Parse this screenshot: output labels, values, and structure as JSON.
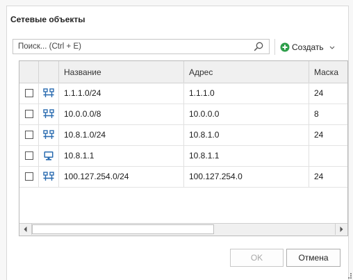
{
  "dialog": {
    "title": "Сетевые объекты"
  },
  "search": {
    "placeholder": "Поиск... (Ctrl + E)",
    "value": ""
  },
  "toolbar": {
    "create_label": "Создать"
  },
  "table": {
    "columns": {
      "name": "Название",
      "address": "Адрес",
      "mask": "Маска"
    },
    "rows": [
      {
        "type": "network",
        "name": "1.1.1.0/24",
        "address": "1.1.1.0",
        "mask": "24",
        "checked": false
      },
      {
        "type": "network",
        "name": "10.0.0.0/8",
        "address": "10.0.0.0",
        "mask": "8",
        "checked": false
      },
      {
        "type": "network",
        "name": "10.8.1.0/24",
        "address": "10.8.1.0",
        "mask": "24",
        "checked": false
      },
      {
        "type": "host",
        "name": "10.8.1.1",
        "address": "10.8.1.1",
        "mask": "",
        "checked": false
      },
      {
        "type": "network",
        "name": "100.127.254.0/24",
        "address": "100.127.254.0",
        "mask": "24",
        "checked": false
      }
    ]
  },
  "buttons": {
    "ok": "OK",
    "cancel": "Отмена"
  },
  "colors": {
    "accent": "#2b6cb0",
    "create_icon": "#2e9e4a",
    "ok_disabled": "#a8a8a8"
  },
  "icons": {
    "search": "search-icon",
    "create": "plus-circle-icon",
    "network": "network-icon",
    "host": "monitor-icon"
  }
}
